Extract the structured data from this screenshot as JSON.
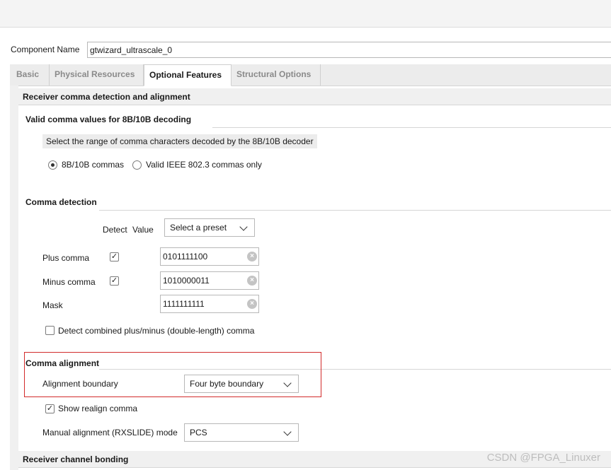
{
  "component": {
    "label": "Component Name",
    "value": "gtwizard_ultrascale_0"
  },
  "tabs": [
    {
      "label": "Basic"
    },
    {
      "label": "Physical Resources"
    },
    {
      "label": "Optional Features"
    },
    {
      "label": "Structural Options"
    }
  ],
  "active_tab": "Optional Features",
  "section": {
    "title": "Receiver comma detection and alignment",
    "valid_comma": {
      "title": "Valid comma values for 8B/10B decoding",
      "hint": "Select the range of comma characters decoded by the 8B/10B decoder",
      "options": [
        {
          "label": "8B/10B commas",
          "selected": true
        },
        {
          "label": "Valid IEEE 802.3 commas only",
          "selected": false
        }
      ]
    },
    "comma_detection": {
      "title": "Comma detection",
      "detect_label": "Detect",
      "value_label": "Value",
      "preset": "Select a preset",
      "rows": [
        {
          "label": "Plus comma",
          "checked": true,
          "value": "0101111100"
        },
        {
          "label": "Minus comma",
          "checked": true,
          "value": "1010000011"
        },
        {
          "label": "Mask",
          "value": "1111111111"
        }
      ],
      "combined_label": "Detect combined plus/minus (double-length) comma",
      "combined_checked": false
    },
    "comma_alignment": {
      "title": "Comma alignment",
      "boundary_label": "Alignment boundary",
      "boundary_value": "Four byte boundary",
      "show_realign_label": "Show realign comma",
      "show_realign_checked": true,
      "manual_label": "Manual alignment (RXSLIDE) mode",
      "manual_value": "PCS"
    }
  },
  "next_section": {
    "title": "Receiver channel bonding"
  },
  "watermark": "CSDN @FPGA_Linuxer",
  "colors": {
    "highlight_border": "#d22b2b",
    "check_mark": "✓"
  }
}
